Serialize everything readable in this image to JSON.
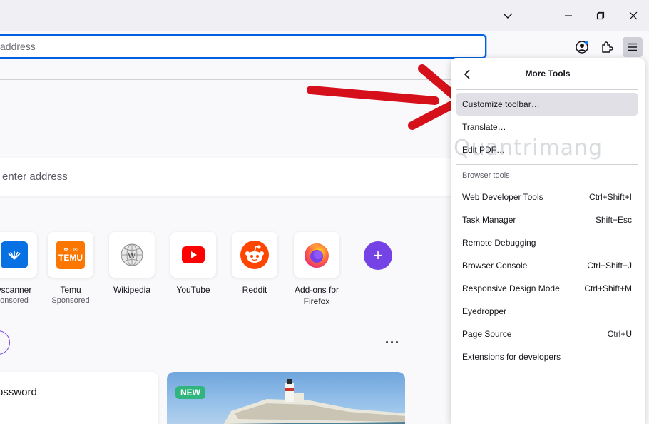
{
  "toolbar": {
    "address_placeholder": "address",
    "list_all_tabs_icon": "chevron-down-icon",
    "minimize_icon": "minimize-icon",
    "restore_icon": "restore-icon",
    "close_icon": "close-icon"
  },
  "newtab": {
    "search_placeholder": "enter address",
    "shortcuts": [
      {
        "label": "yscanner",
        "sub": "onsored"
      },
      {
        "label": "Temu",
        "sub": "Sponsored",
        "logo_text": "TEMU"
      },
      {
        "label": "Wikipedia",
        "sub": ""
      },
      {
        "label": "YouTube",
        "sub": ""
      },
      {
        "label": "Reddit",
        "sub": ""
      },
      {
        "label": "Add-ons for Firefox",
        "sub": ""
      }
    ],
    "add_shortcut": "+",
    "more": "···",
    "card_left_title": "ossword",
    "card_badge": "NEW"
  },
  "menu": {
    "title": "More Tools",
    "items_top": [
      {
        "label": "Customize toolbar…"
      },
      {
        "label": "Translate…"
      },
      {
        "label": "Edit PDF…"
      }
    ],
    "section_label": "Browser tools",
    "items_tools": [
      {
        "label": "Web Developer Tools",
        "shortcut": "Ctrl+Shift+I"
      },
      {
        "label": "Task Manager",
        "shortcut": "Shift+Esc"
      },
      {
        "label": "Remote Debugging",
        "shortcut": ""
      },
      {
        "label": "Browser Console",
        "shortcut": "Ctrl+Shift+J"
      },
      {
        "label": "Responsive Design Mode",
        "shortcut": "Ctrl+Shift+M"
      },
      {
        "label": "Eyedropper",
        "shortcut": ""
      },
      {
        "label": "Page Source",
        "shortcut": "Ctrl+U"
      },
      {
        "label": "Extensions for developers",
        "shortcut": ""
      }
    ]
  },
  "watermark": "Quantrimang",
  "colors": {
    "accent": "#0061e0",
    "add_button": "#7542e5",
    "arrow": "#d6101a",
    "new_badge": "#2fb57d"
  }
}
